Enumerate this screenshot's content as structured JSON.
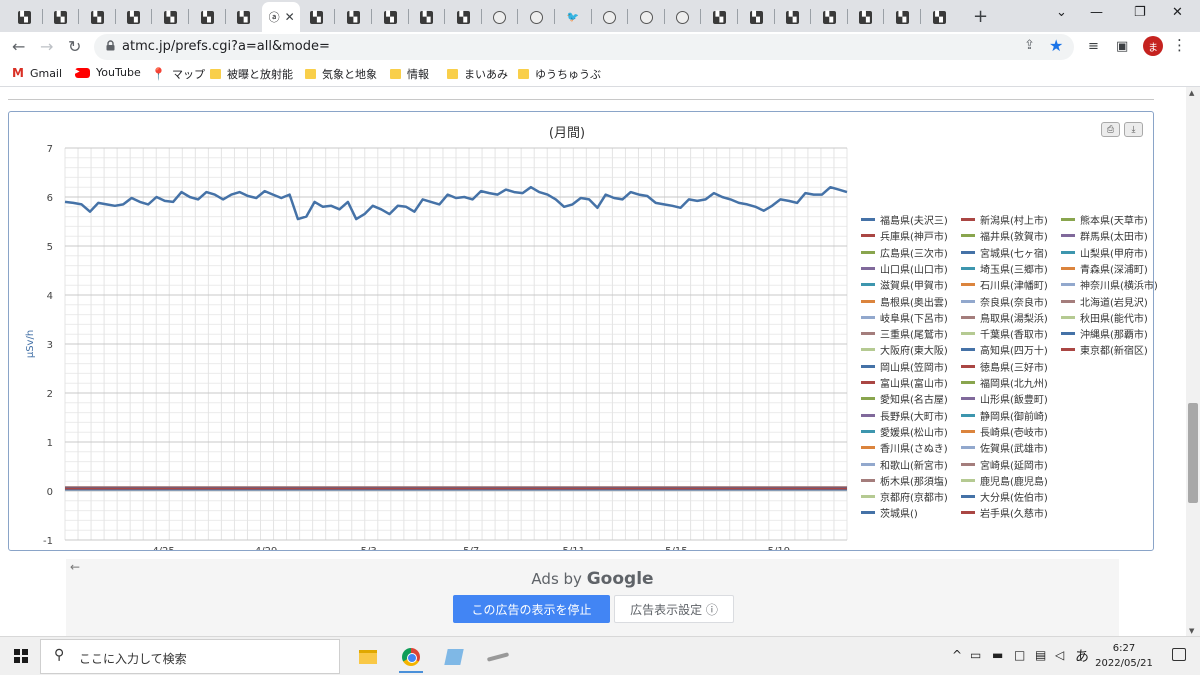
{
  "browser": {
    "tabs": [
      {
        "favicon": "site-icon"
      },
      {
        "favicon": "site-icon"
      },
      {
        "favicon": "site-icon"
      },
      {
        "favicon": "site-icon"
      },
      {
        "favicon": "site-icon"
      },
      {
        "favicon": "site-icon"
      },
      {
        "favicon": "site-icon"
      },
      {
        "favicon": "active-page-icon",
        "active": true
      },
      {
        "favicon": "site-icon"
      },
      {
        "favicon": "site-icon"
      },
      {
        "favicon": "site-icon"
      },
      {
        "favicon": "site-icon"
      },
      {
        "favicon": "site-icon"
      },
      {
        "favicon": "globe-icon"
      },
      {
        "favicon": "globe-icon"
      },
      {
        "favicon": "twitter-icon"
      },
      {
        "favicon": "globe-icon"
      },
      {
        "favicon": "globe-icon"
      },
      {
        "favicon": "globe-icon"
      },
      {
        "favicon": "site-icon"
      },
      {
        "favicon": "site-icon"
      },
      {
        "favicon": "site-icon"
      },
      {
        "favicon": "site-icon"
      },
      {
        "favicon": "site-icon"
      },
      {
        "favicon": "site-icon"
      },
      {
        "favicon": "site-icon"
      }
    ],
    "url": "atmc.jp/prefs.cgi?a=all&mode=",
    "avatar_letter": "ま",
    "bookmarks": [
      {
        "label": "Gmail",
        "icon": "gmail-icon"
      },
      {
        "label": "YouTube",
        "icon": "youtube-icon"
      },
      {
        "label": "マップ",
        "icon": "maps-icon"
      },
      {
        "label": "被曝と放射能",
        "icon": "folder-icon"
      },
      {
        "label": "気象と地象",
        "icon": "folder-icon"
      },
      {
        "label": "情報",
        "icon": "folder-icon"
      },
      {
        "label": "まいあみ",
        "icon": "folder-icon"
      },
      {
        "label": "ゆうちゅうぶ",
        "icon": "folder-icon"
      }
    ]
  },
  "chart_data": {
    "type": "line",
    "title": "(月間)",
    "ylabel": "μSv/h",
    "xlabel": "",
    "ylim": [
      -1,
      7
    ],
    "yticks": [
      "-1",
      "0",
      "1",
      "2",
      "3",
      "4",
      "5",
      "6",
      "7"
    ],
    "xticks": [
      "4/25",
      "4/29",
      "5/3",
      "5/7",
      "5/11",
      "5/15",
      "5/19"
    ],
    "grid": true,
    "legend_position": "right",
    "x_start": "4/21",
    "x_end": "5/21",
    "series": [
      {
        "name": "福島県(夫沢三)",
        "color": "#4572a7",
        "values": [
          5.9,
          5.88,
          5.85,
          5.7,
          5.88,
          5.85,
          5.82,
          5.85,
          5.98,
          5.9,
          5.85,
          6.0,
          5.92,
          5.9,
          6.1,
          6.0,
          5.95,
          6.1,
          6.05,
          5.95,
          6.05,
          6.1,
          6.02,
          5.98,
          6.12,
          6.05,
          5.98,
          6.05,
          5.55,
          5.6,
          5.9,
          5.8,
          5.82,
          5.75,
          5.9,
          5.55,
          5.65,
          5.82,
          5.75,
          5.65,
          5.82,
          5.8,
          5.7,
          5.95,
          5.9,
          5.85,
          6.05,
          5.98,
          6.0,
          5.95,
          6.12,
          6.08,
          6.05,
          6.15,
          6.1,
          6.08,
          6.2,
          6.1,
          6.05,
          5.95,
          5.8,
          5.85,
          5.98,
          5.95,
          5.78,
          6.05,
          5.98,
          5.95,
          6.1,
          6.05,
          6.02,
          5.88,
          5.85,
          5.82,
          5.78,
          5.95,
          5.92,
          5.95,
          6.08,
          6.0,
          5.95,
          5.88,
          5.85,
          5.8,
          5.72,
          5.82,
          5.95,
          5.92,
          5.88,
          6.08,
          6.05,
          6.05,
          6.2,
          6.15,
          6.1
        ]
      },
      {
        "name": "新潟県(村上市)",
        "color": "#aa4643",
        "values": [
          0.04
        ]
      },
      {
        "name": "熊本県(天草市)",
        "color": "#89a54e",
        "values": [
          0.03
        ]
      },
      {
        "name": "兵庫県(神戸市)",
        "color": "#aa4643",
        "values": [
          0.05
        ]
      },
      {
        "name": "福井県(敦賀市)",
        "color": "#89a54e",
        "values": [
          0.05
        ]
      },
      {
        "name": "群馬県(太田市)",
        "color": "#80699b",
        "values": [
          0.03
        ]
      },
      {
        "name": "広島県(三次市)",
        "color": "#89a54e",
        "values": [
          0.04
        ]
      },
      {
        "name": "宮城県(七ヶ宿)",
        "color": "#4572a7",
        "values": [
          0.04
        ]
      },
      {
        "name": "山梨県(甲府市)",
        "color": "#3d96ae",
        "values": [
          0.04
        ]
      },
      {
        "name": "山口県(山口市)",
        "color": "#80699b",
        "values": [
          0.05
        ]
      },
      {
        "name": "埼玉県(三郷市)",
        "color": "#3d96ae",
        "values": [
          0.04
        ]
      },
      {
        "name": "青森県(深浦町)",
        "color": "#db843d",
        "values": [
          0.03
        ]
      },
      {
        "name": "滋賀県(甲賀市)",
        "color": "#3d96ae",
        "values": [
          0.04
        ]
      },
      {
        "name": "石川県(津幡町)",
        "color": "#db843d",
        "values": [
          0.05
        ]
      },
      {
        "name": "神奈川県(横浜市)",
        "color": "#92a8cd",
        "values": [
          0.04
        ]
      },
      {
        "name": "島根県(奥出雲)",
        "color": "#db843d",
        "values": [
          0.06
        ]
      },
      {
        "name": "奈良県(奈良市)",
        "color": "#92a8cd",
        "values": [
          0.05
        ]
      },
      {
        "name": "北海道(岩見沢)",
        "color": "#a47d7c",
        "values": [
          0.03
        ]
      },
      {
        "name": "岐阜県(下呂市)",
        "color": "#92a8cd",
        "values": [
          0.07
        ]
      },
      {
        "name": "鳥取県(湯梨浜)",
        "color": "#a47d7c",
        "values": [
          0.05
        ]
      },
      {
        "name": "秋田県(能代市)",
        "color": "#b5ca92",
        "values": [
          0.04
        ]
      },
      {
        "name": "三重県(尾鷲市)",
        "color": "#a47d7c",
        "values": [
          0.05
        ]
      },
      {
        "name": "千葉県(香取市)",
        "color": "#b5ca92",
        "values": [
          0.04
        ]
      },
      {
        "name": "沖縄県(那覇市)",
        "color": "#4572a7",
        "values": [
          0.03
        ]
      },
      {
        "name": "大阪府(東大阪)",
        "color": "#b5ca92",
        "values": [
          0.05
        ]
      },
      {
        "name": "高知県(四万十)",
        "color": "#4572a7",
        "values": [
          0.05
        ]
      },
      {
        "name": "東京都(新宿区)",
        "color": "#aa4643",
        "values": [
          0.04
        ]
      },
      {
        "name": "岡山県(笠岡市)",
        "color": "#4572a7",
        "values": [
          0.05
        ]
      },
      {
        "name": "徳島県(三好市)",
        "color": "#aa4643",
        "values": [
          0.05
        ]
      },
      {
        "name": "富山県(富山市)",
        "color": "#aa4643",
        "values": [
          0.05
        ]
      },
      {
        "name": "福岡県(北九州)",
        "color": "#89a54e",
        "values": [
          0.05
        ]
      },
      {
        "name": "愛知県(名古屋)",
        "color": "#89a54e",
        "values": [
          0.04
        ]
      },
      {
        "name": "山形県(飯豊町)",
        "color": "#80699b",
        "values": [
          0.05
        ]
      },
      {
        "name": "長野県(大町市)",
        "color": "#80699b",
        "values": [
          0.05
        ]
      },
      {
        "name": "静岡県(御前崎)",
        "color": "#3d96ae",
        "values": [
          0.04
        ]
      },
      {
        "name": "愛媛県(松山市)",
        "color": "#3d96ae",
        "values": [
          0.05
        ]
      },
      {
        "name": "長崎県(壱岐市)",
        "color": "#db843d",
        "values": [
          0.04
        ]
      },
      {
        "name": "香川県(さぬき)",
        "color": "#db843d",
        "values": [
          0.06
        ]
      },
      {
        "name": "佐賀県(武雄市)",
        "color": "#92a8cd",
        "values": [
          0.05
        ]
      },
      {
        "name": "和歌山(新宮市)",
        "color": "#92a8cd",
        "values": [
          0.05
        ]
      },
      {
        "name": "宮崎県(延岡市)",
        "color": "#a47d7c",
        "values": [
          0.05
        ]
      },
      {
        "name": "栃木県(那須塩)",
        "color": "#a47d7c",
        "values": [
          0.08
        ]
      },
      {
        "name": "鹿児島(鹿児島)",
        "color": "#b5ca92",
        "values": [
          0.06
        ]
      },
      {
        "name": "京都府(京都市)",
        "color": "#b5ca92",
        "values": [
          0.05
        ]
      },
      {
        "name": "大分県(佐伯市)",
        "color": "#4572a7",
        "values": [
          0.04
        ]
      },
      {
        "name": "茨城県()",
        "color": "#4572a7",
        "values": [
          0.06
        ]
      },
      {
        "name": "岩手県(久慈市)",
        "color": "#aa4643",
        "values": [
          0.05
        ]
      }
    ]
  },
  "ad": {
    "ads_by": "Ads by",
    "google": "Google",
    "stop_label": "この広告の表示を停止",
    "settings_label": "広告表示設定 ⓘ"
  },
  "taskbar": {
    "search_placeholder": "ここに入力して検索",
    "ime": "あ",
    "time": "6:27",
    "date": "2022/05/21"
  }
}
